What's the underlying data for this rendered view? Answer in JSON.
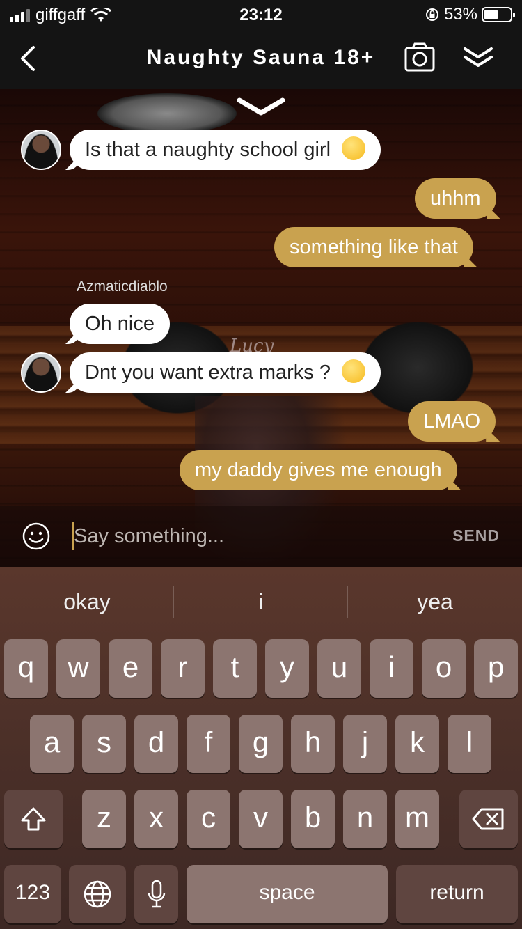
{
  "status_bar": {
    "carrier": "giffgaff",
    "time": "23:12",
    "battery": "53%"
  },
  "header": {
    "title": "Naughty Sauna 18+"
  },
  "messages": [
    {
      "text": "Is that a naughty school girl"
    },
    {
      "text": "uhhm"
    },
    {
      "text": "something like that"
    },
    {
      "sender": "Azmaticdiablo",
      "text": "Oh nice"
    },
    {
      "text": "Dnt you want extra marks ?"
    },
    {
      "text": "LMAO"
    },
    {
      "text": "my daddy gives me enough"
    }
  ],
  "background_sign": "Lucy",
  "input": {
    "placeholder": "Say something...",
    "send_label": "SEND"
  },
  "keyboard": {
    "suggestions": [
      "okay",
      "i",
      "yea"
    ],
    "row1": [
      "q",
      "w",
      "e",
      "r",
      "t",
      "y",
      "u",
      "i",
      "o",
      "p"
    ],
    "row2": [
      "a",
      "s",
      "d",
      "f",
      "g",
      "h",
      "j",
      "k",
      "l"
    ],
    "row3": [
      "z",
      "x",
      "c",
      "v",
      "b",
      "n",
      "m"
    ],
    "numbers_label": "123",
    "space_label": "space",
    "return_label": "return"
  },
  "colors": {
    "outgoing_bubble": "#c9a24f",
    "incoming_bubble": "#ffffff",
    "header_bg": "#141414"
  }
}
